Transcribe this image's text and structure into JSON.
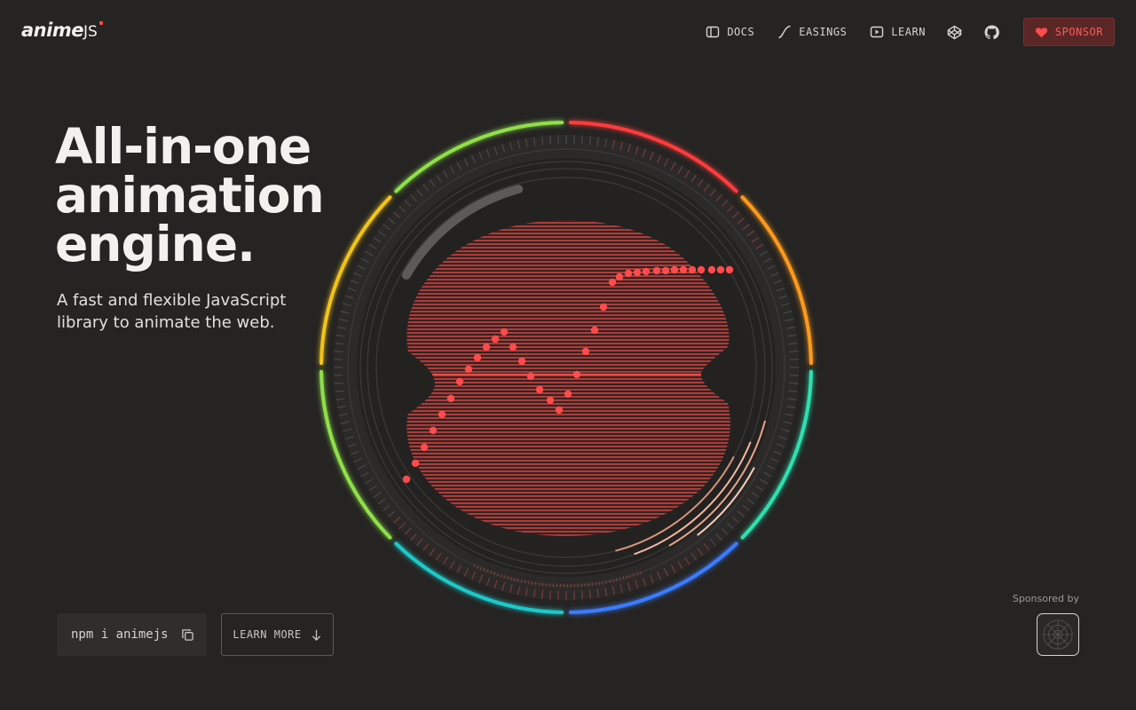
{
  "header": {
    "logo_text": "anime",
    "logo_suffix": "JS",
    "nav": [
      {
        "label": "DOCS",
        "icon": "docs-panel-icon"
      },
      {
        "label": "EASINGS",
        "icon": "easing-curve-icon"
      },
      {
        "label": "LEARN",
        "icon": "play-video-icon"
      }
    ],
    "codepen_icon": "codepen-icon",
    "github_icon": "github-icon",
    "sponsor_label": "SPONSOR",
    "sponsor_icon": "heart-icon"
  },
  "hero": {
    "headline_lines": [
      "All-in-one",
      "animation",
      "engine."
    ],
    "subtitle": "A fast and flexible JavaScript library to animate the web."
  },
  "actions": {
    "install_command": "npm i animejs",
    "copy_icon": "copy-icon",
    "learn_more_label": "LEARN MORE",
    "learn_more_icon": "arrow-down-icon"
  },
  "sponsors": {
    "label": "Sponsored by",
    "logo_icon": "sponsor-logo-icon"
  },
  "colors": {
    "background": "#252423",
    "accent_red": "#ff4b4b",
    "ring": [
      "#ff3b3b",
      "#ff9a1f",
      "#f2c418",
      "#8fe04a",
      "#3bd46b",
      "#1fc9c9",
      "#3a7bff",
      "#2fe0b0"
    ]
  }
}
